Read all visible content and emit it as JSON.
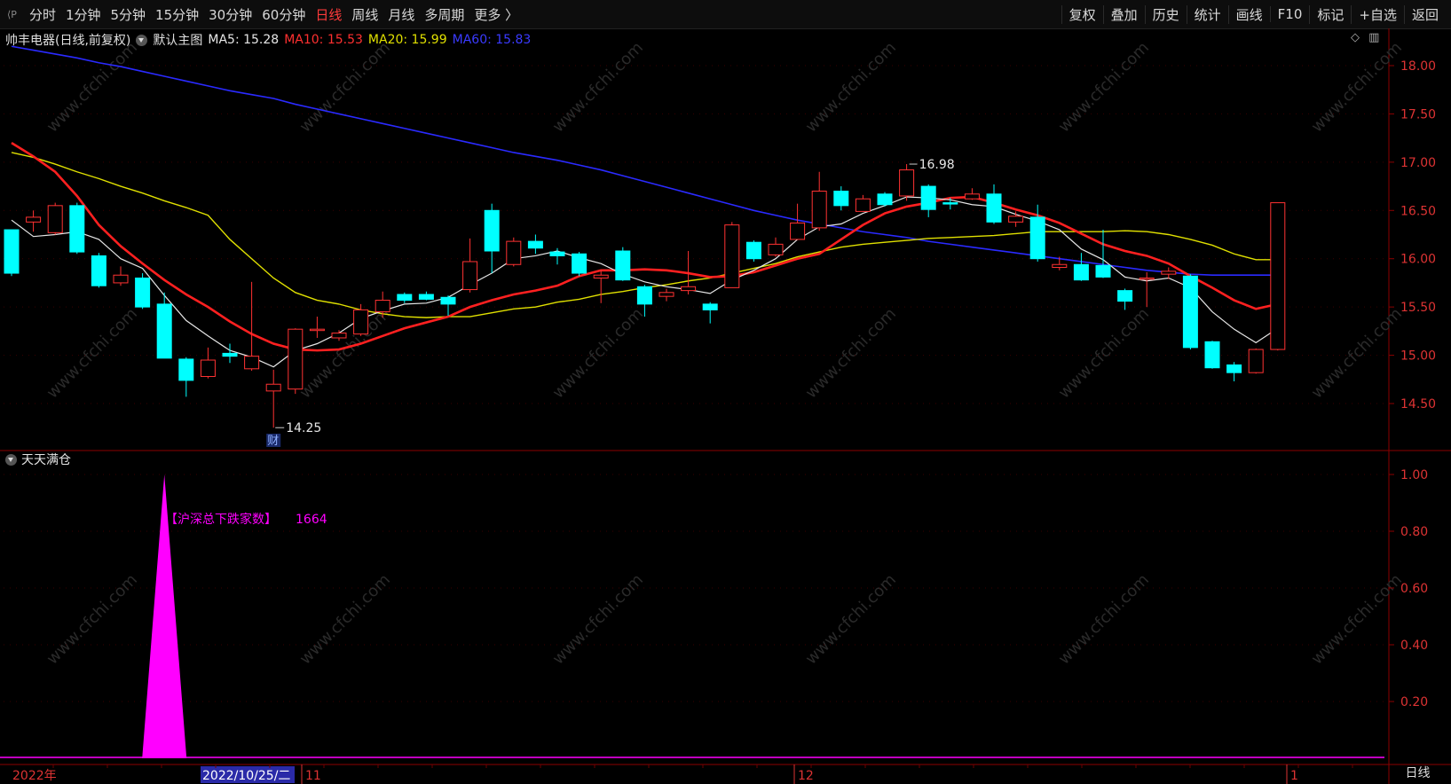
{
  "toolbar": {
    "left_mark": "⟨P",
    "periods": [
      "分时",
      "1分钟",
      "5分钟",
      "15分钟",
      "30分钟",
      "60分钟",
      "日线",
      "周线",
      "月线",
      "多周期",
      "更多 〉"
    ],
    "active_period": "日线",
    "right_buttons": [
      "复权",
      "叠加",
      "历史",
      "统计",
      "画线",
      "F10",
      "标记",
      "+自选",
      "返回"
    ]
  },
  "main_info": {
    "stock": "帅丰电器(日线,前复权)",
    "template": "默认主图",
    "ma5": "MA5: 15.28",
    "ma10": "MA10: 15.53",
    "ma20": "MA20: 15.99",
    "ma60": "MA60: 15.83"
  },
  "colors": {
    "up": "#ff3232",
    "down": "#00ffff",
    "ma5": "#e6e6e6",
    "ma10": "#ff2020",
    "ma20": "#e0e000",
    "ma60": "#2a2aff",
    "indicator": "#ff00ff",
    "frame": "#8b0000"
  },
  "price_axis": [
    "18.00",
    "17.50",
    "17.00",
    "16.50",
    "16.00",
    "15.50",
    "15.00",
    "14.50"
  ],
  "annotations": {
    "high": "16.98",
    "low": "14.25",
    "cai_badge": "财"
  },
  "indicator": {
    "name": "天天满仓",
    "label": "【沪深总下跌家数】",
    "value": "1664",
    "axis": [
      "1.00",
      "0.80",
      "0.60",
      "0.40",
      "0.20"
    ],
    "peak": 1.0
  },
  "x_axis": {
    "year": "2022年",
    "cursor_date": "2022/10/25/二",
    "month_11": "11",
    "month_12": "12",
    "month_1": "1"
  },
  "bottom_right": "日线",
  "watermark": "www.cfchi.com",
  "chart_data": {
    "type": "candlestick",
    "ylim": [
      14.1,
      18.2
    ],
    "candles": [
      {
        "o": 16.3,
        "c": 15.85,
        "h": 16.3,
        "l": 15.82
      },
      {
        "o": 16.38,
        "c": 16.43,
        "h": 16.5,
        "l": 16.28
      },
      {
        "o": 16.27,
        "c": 16.55,
        "h": 16.58,
        "l": 16.25
      },
      {
        "o": 16.55,
        "c": 16.07,
        "h": 16.58,
        "l": 16.05
      },
      {
        "o": 16.03,
        "c": 15.72,
        "h": 16.06,
        "l": 15.7
      },
      {
        "o": 15.75,
        "c": 15.83,
        "h": 15.92,
        "l": 15.72
      },
      {
        "o": 15.8,
        "c": 15.5,
        "h": 15.85,
        "l": 15.48
      },
      {
        "o": 15.53,
        "c": 14.97,
        "h": 15.65,
        "l": 14.97
      },
      {
        "o": 14.96,
        "c": 14.74,
        "h": 14.98,
        "l": 14.57
      },
      {
        "o": 14.78,
        "c": 14.95,
        "h": 15.08,
        "l": 14.76
      },
      {
        "o": 15.02,
        "c": 14.99,
        "h": 15.12,
        "l": 14.92
      },
      {
        "o": 14.86,
        "c": 14.99,
        "h": 15.76,
        "l": 14.84
      },
      {
        "o": 14.63,
        "c": 14.7,
        "h": 14.85,
        "l": 14.25
      },
      {
        "o": 14.65,
        "c": 15.27,
        "h": 15.28,
        "l": 14.6
      },
      {
        "o": 15.27,
        "c": 15.27,
        "h": 15.4,
        "l": 15.18
      },
      {
        "o": 15.18,
        "c": 15.23,
        "h": 15.26,
        "l": 15.15
      },
      {
        "o": 15.22,
        "c": 15.47,
        "h": 15.53,
        "l": 15.2
      },
      {
        "o": 15.45,
        "c": 15.57,
        "h": 15.66,
        "l": 15.39
      },
      {
        "o": 15.63,
        "c": 15.57,
        "h": 15.65,
        "l": 15.54
      },
      {
        "o": 15.63,
        "c": 15.58,
        "h": 15.66,
        "l": 15.57
      },
      {
        "o": 15.6,
        "c": 15.53,
        "h": 15.62,
        "l": 15.41
      },
      {
        "o": 15.68,
        "c": 15.97,
        "h": 16.21,
        "l": 15.65
      },
      {
        "o": 16.5,
        "c": 16.08,
        "h": 16.57,
        "l": 15.85
      },
      {
        "o": 15.94,
        "c": 16.18,
        "h": 16.22,
        "l": 15.92
      },
      {
        "o": 16.18,
        "c": 16.11,
        "h": 16.25,
        "l": 16.05
      },
      {
        "o": 16.07,
        "c": 16.03,
        "h": 16.11,
        "l": 15.94
      },
      {
        "o": 16.05,
        "c": 15.85,
        "h": 16.07,
        "l": 15.82
      },
      {
        "o": 15.8,
        "c": 15.83,
        "h": 15.88,
        "l": 15.54
      },
      {
        "o": 16.08,
        "c": 15.78,
        "h": 16.12,
        "l": 15.77
      },
      {
        "o": 15.71,
        "c": 15.53,
        "h": 15.73,
        "l": 15.4
      },
      {
        "o": 15.61,
        "c": 15.65,
        "h": 15.69,
        "l": 15.56
      },
      {
        "o": 15.67,
        "c": 15.71,
        "h": 16.08,
        "l": 15.63
      },
      {
        "o": 15.53,
        "c": 15.47,
        "h": 15.55,
        "l": 15.33
      },
      {
        "o": 15.7,
        "c": 16.35,
        "h": 16.38,
        "l": 15.7
      },
      {
        "o": 16.17,
        "c": 16.0,
        "h": 16.19,
        "l": 15.97
      },
      {
        "o": 16.04,
        "c": 16.15,
        "h": 16.22,
        "l": 16.02
      },
      {
        "o": 16.2,
        "c": 16.37,
        "h": 16.57,
        "l": 16.2
      },
      {
        "o": 16.32,
        "c": 16.7,
        "h": 16.9,
        "l": 16.29
      },
      {
        "o": 16.7,
        "c": 16.55,
        "h": 16.75,
        "l": 16.5
      },
      {
        "o": 16.49,
        "c": 16.62,
        "h": 16.66,
        "l": 16.49
      },
      {
        "o": 16.67,
        "c": 16.56,
        "h": 16.69,
        "l": 16.54
      },
      {
        "o": 16.65,
        "c": 16.92,
        "h": 16.98,
        "l": 16.6
      },
      {
        "o": 16.75,
        "c": 16.51,
        "h": 16.77,
        "l": 16.43
      },
      {
        "o": 16.58,
        "c": 16.57,
        "h": 16.63,
        "l": 16.51
      },
      {
        "o": 16.62,
        "c": 16.67,
        "h": 16.73,
        "l": 16.61
      },
      {
        "o": 16.67,
        "c": 16.38,
        "h": 16.77,
        "l": 16.36
      },
      {
        "o": 16.38,
        "c": 16.44,
        "h": 16.49,
        "l": 16.33
      },
      {
        "o": 16.43,
        "c": 16.0,
        "h": 16.56,
        "l": 15.97
      },
      {
        "o": 15.91,
        "c": 15.94,
        "h": 16.02,
        "l": 15.88
      },
      {
        "o": 15.94,
        "c": 15.78,
        "h": 16.06,
        "l": 15.77
      },
      {
        "o": 15.93,
        "c": 15.81,
        "h": 16.3,
        "l": 15.8
      },
      {
        "o": 15.67,
        "c": 15.56,
        "h": 15.69,
        "l": 15.47
      },
      {
        "o": 15.79,
        "c": 15.8,
        "h": 15.86,
        "l": 15.5
      },
      {
        "o": 15.84,
        "c": 15.87,
        "h": 15.91,
        "l": 15.79
      },
      {
        "o": 15.82,
        "c": 15.08,
        "h": 15.84,
        "l": 15.06
      },
      {
        "o": 15.14,
        "c": 14.87,
        "h": 15.15,
        "l": 14.86
      },
      {
        "o": 14.9,
        "c": 14.82,
        "h": 14.93,
        "l": 14.73
      },
      {
        "o": 14.82,
        "c": 15.06,
        "h": 15.07,
        "l": 14.81
      },
      {
        "o": 15.06,
        "c": 16.58,
        "h": 16.58,
        "l": 15.05
      }
    ],
    "ma5": [
      16.4,
      16.23,
      16.25,
      16.28,
      16.2,
      16.0,
      15.9,
      15.62,
      15.36,
      15.2,
      15.05,
      14.98,
      14.88,
      15.05,
      15.12,
      15.23,
      15.38,
      15.46,
      15.53,
      15.54,
      15.6,
      15.73,
      15.85,
      16.0,
      16.03,
      16.08,
      16.01,
      15.95,
      15.84,
      15.76,
      15.71,
      15.68,
      15.64,
      15.78,
      15.88,
      16.0,
      16.2,
      16.33,
      16.36,
      16.47,
      16.55,
      16.64,
      16.63,
      16.61,
      16.56,
      16.54,
      16.46,
      16.39,
      16.3,
      16.1,
      15.99,
      15.81,
      15.77,
      15.8,
      15.7,
      15.45,
      15.27,
      15.13,
      15.28
    ],
    "ma10": [
      17.2,
      17.06,
      16.9,
      16.65,
      16.35,
      16.13,
      15.95,
      15.78,
      15.63,
      15.5,
      15.35,
      15.22,
      15.12,
      15.06,
      15.05,
      15.06,
      15.12,
      15.2,
      15.28,
      15.34,
      15.4,
      15.5,
      15.57,
      15.63,
      15.67,
      15.72,
      15.82,
      15.88,
      15.88,
      15.89,
      15.88,
      15.85,
      15.81,
      15.82,
      15.86,
      15.93,
      16.0,
      16.05,
      16.2,
      16.35,
      16.47,
      16.54,
      16.58,
      16.63,
      16.64,
      16.58,
      16.51,
      16.45,
      16.37,
      16.26,
      16.15,
      16.08,
      16.03,
      15.95,
      15.82,
      15.7,
      15.57,
      15.48,
      15.53
    ],
    "ma20": [
      17.1,
      17.05,
      16.98,
      16.9,
      16.83,
      16.75,
      16.68,
      16.6,
      16.53,
      16.45,
      16.2,
      16.0,
      15.8,
      15.65,
      15.57,
      15.53,
      15.47,
      15.43,
      15.4,
      15.39,
      15.4,
      15.4,
      15.44,
      15.48,
      15.5,
      15.55,
      15.58,
      15.63,
      15.66,
      15.7,
      15.73,
      15.77,
      15.8,
      15.85,
      15.9,
      15.95,
      16.02,
      16.07,
      16.12,
      16.15,
      16.17,
      16.19,
      16.21,
      16.22,
      16.23,
      16.24,
      16.26,
      16.28,
      16.28,
      16.28,
      16.28,
      16.29,
      16.28,
      16.25,
      16.2,
      16.14,
      16.05,
      15.99,
      15.99
    ],
    "ma60": [
      18.2,
      18.16,
      18.12,
      18.08,
      18.03,
      17.99,
      17.94,
      17.89,
      17.84,
      17.79,
      17.74,
      17.7,
      17.66,
      17.6,
      17.55,
      17.5,
      17.45,
      17.4,
      17.35,
      17.3,
      17.25,
      17.2,
      17.15,
      17.1,
      17.06,
      17.02,
      16.97,
      16.92,
      16.86,
      16.8,
      16.74,
      16.68,
      16.62,
      16.56,
      16.5,
      16.45,
      16.4,
      16.36,
      16.32,
      16.28,
      16.25,
      16.22,
      16.18,
      16.15,
      16.12,
      16.09,
      16.06,
      16.03,
      16.0,
      15.97,
      15.94,
      15.91,
      15.88,
      15.86,
      15.84,
      15.83,
      15.83,
      15.83,
      15.83
    ]
  }
}
